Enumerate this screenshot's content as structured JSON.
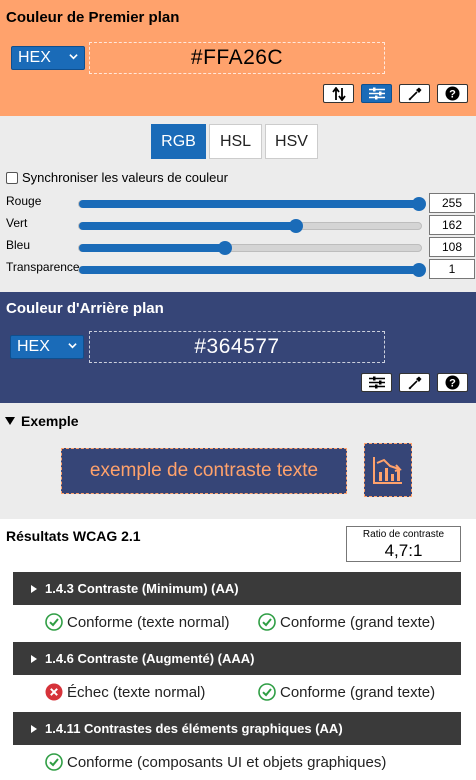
{
  "foreground": {
    "title": "Couleur de Premier plan",
    "format": "HEX",
    "value": "#FFA26C",
    "color": "#ffa26c"
  },
  "model": {
    "tabs": [
      {
        "label": "RGB",
        "active": true
      },
      {
        "label": "HSL",
        "active": false
      },
      {
        "label": "HSV",
        "active": false
      }
    ],
    "sync_label": "Synchroniser les valeurs de couleur",
    "sync_checked": false,
    "sliders": [
      {
        "label": "Rouge",
        "value": "255",
        "max": 255
      },
      {
        "label": "Vert",
        "value": "162",
        "max": 255
      },
      {
        "label": "Bleu",
        "value": "108",
        "max": 255
      },
      {
        "label": "Transparence",
        "value": "1",
        "max": 1
      }
    ]
  },
  "background": {
    "title": "Couleur d'Arrière plan",
    "format": "HEX",
    "value": "#364577",
    "color": "#364577"
  },
  "example": {
    "title": "Exemple",
    "text": "exemple de contraste texte"
  },
  "results": {
    "title": "Résultats WCAG 2.1",
    "ratio_label": "Ratio de contraste",
    "ratio_value": "4,7:1",
    "criteria": [
      {
        "label": "1.4.3 Contraste (Minimum) (AA)",
        "results": [
          {
            "text": "Conforme (texte normal)",
            "pass": true
          },
          {
            "text": "Conforme (grand texte)",
            "pass": true
          }
        ]
      },
      {
        "label": "1.4.6 Contraste (Augmenté) (AAA)",
        "results": [
          {
            "text": "Échec (texte normal)",
            "pass": false
          },
          {
            "text": "Conforme (grand texte)",
            "pass": true
          }
        ]
      },
      {
        "label": "1.4.11 Contrastes des éléments graphiques (AA)",
        "results": [
          {
            "text": "Conforme (composants UI et objets graphiques)",
            "pass": true
          }
        ]
      }
    ]
  },
  "icons": {
    "swap": "swap-arrows-icon",
    "sliders": "sliders-icon",
    "picker": "eyedropper-icon",
    "help": "help-icon",
    "chart": "chart-icon",
    "pass": "check-circle-icon",
    "fail": "x-circle-icon"
  },
  "colors": {
    "accent": "#1a6bb8",
    "pass": "#2f9e44",
    "fail": "#d6333a"
  }
}
